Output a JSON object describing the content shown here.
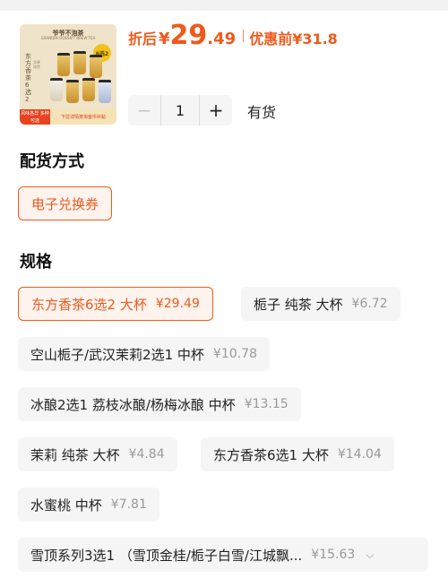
{
  "product": {
    "image": {
      "brand": "爷爷不泡茶",
      "brand_sub": "GRANDPA DOESN'T BREW TEA",
      "badge": "6选2",
      "vertical_title": "东方香茶6选2",
      "vertical_sub": "大杯 冰饮",
      "promo_left": "风味各异 多种可选",
      "promo_right": "下拉详情按淘金币补贴"
    },
    "price_label": "折后",
    "price_currency": "¥",
    "price_int": "29",
    "price_decimal": ".49",
    "original_label": "优惠前",
    "original_price": "¥31.8",
    "accent_color": "#ee5a1c"
  },
  "quantity": {
    "minus_label": "−",
    "value": "1",
    "plus_label": "+",
    "stock_status": "有货"
  },
  "delivery": {
    "title": "配货方式",
    "options": [
      {
        "label": "电子兑换券",
        "selected": true
      }
    ]
  },
  "spec": {
    "title": "规格",
    "options": [
      {
        "label": "东方香茶6选2 大杯",
        "price": "¥29.49",
        "selected": true
      },
      {
        "label": "栀子 纯茶 大杯",
        "price": "¥6.72",
        "selected": false
      },
      {
        "label": "空山栀子/武汉茉莉2选1 中杯",
        "price": "¥10.78",
        "selected": false
      },
      {
        "label": "冰酿2选1 荔枝冰酿/杨梅冰酿 中杯",
        "price": "¥13.15",
        "selected": false
      },
      {
        "label": "茉莉 纯茶 大杯",
        "price": "¥4.84",
        "selected": false
      },
      {
        "label": "东方香茶6选1 大杯",
        "price": "¥14.04",
        "selected": false
      },
      {
        "label": "水蜜桃 中杯",
        "price": "¥7.81",
        "selected": false
      },
      {
        "label": "雪顶系列3选1 （雪顶金桂/栀子白雪/江城飘...",
        "price": "¥15.63",
        "selected": false,
        "expand_icon": "chevron-down-icon"
      }
    ]
  }
}
